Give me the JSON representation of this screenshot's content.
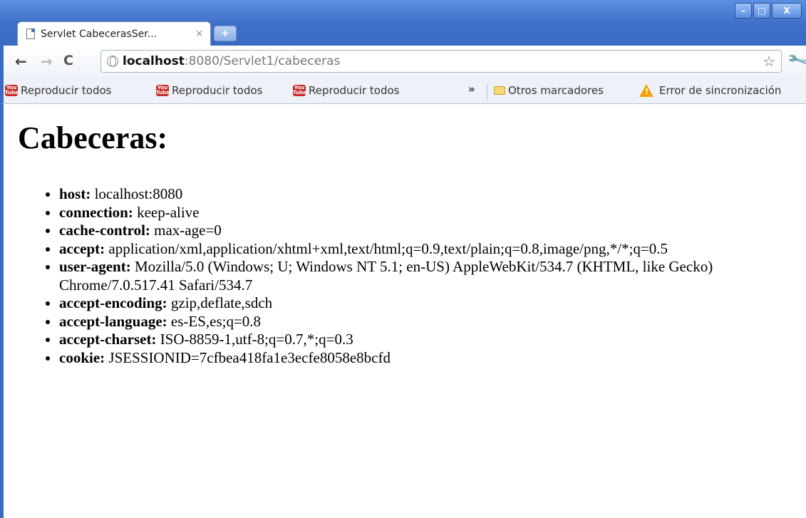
{
  "window": {
    "minimize_glyph": "–",
    "maximize_glyph": "□",
    "close_glyph": "X"
  },
  "tab": {
    "title": "Servlet CabecerasSer...",
    "close_glyph": "×",
    "new_tab_glyph": "+"
  },
  "toolbar": {
    "back_glyph": "←",
    "forward_glyph": "→",
    "reload_glyph": "C",
    "url_host": "localhost",
    "url_rest": ":8080/Servlet1/cabeceras",
    "star_glyph": "☆",
    "wrench_glyph": "🔧"
  },
  "bookmarks": {
    "items": [
      {
        "label": "Reproducir todos",
        "icon": "youtube-icon"
      },
      {
        "label": "Reproducir todos",
        "icon": "youtube-icon"
      },
      {
        "label": "Reproducir todos",
        "icon": "youtube-icon"
      }
    ],
    "overflow_glyph": "»",
    "other": "Otros marcadores",
    "sync_error": "Error de sincronización"
  },
  "content": {
    "heading": "Cabeceras:",
    "headers": [
      {
        "name": "host:",
        "value": "localhost:8080"
      },
      {
        "name": "connection:",
        "value": "keep-alive"
      },
      {
        "name": "cache-control:",
        "value": "max-age=0"
      },
      {
        "name": "accept:",
        "value": "application/xml,application/xhtml+xml,text/html;q=0.9,text/plain;q=0.8,image/png,*/*;q=0.5"
      },
      {
        "name": "user-agent:",
        "value": "Mozilla/5.0 (Windows; U; Windows NT 5.1; en-US) AppleWebKit/534.7 (KHTML, like Gecko) Chrome/7.0.517.41 Safari/534.7"
      },
      {
        "name": "accept-encoding:",
        "value": "gzip,deflate,sdch"
      },
      {
        "name": "accept-language:",
        "value": "es-ES,es;q=0.8"
      },
      {
        "name": "accept-charset:",
        "value": "ISO-8859-1,utf-8;q=0.7,*;q=0.3"
      },
      {
        "name": "cookie:",
        "value": "JSESSIONID=7cfbea418fa1e3ecfe8058e8bcfd"
      }
    ]
  }
}
